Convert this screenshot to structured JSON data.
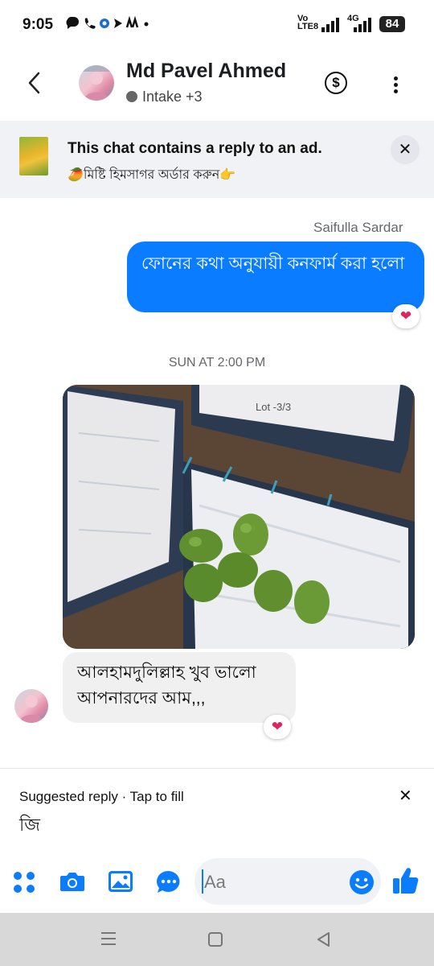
{
  "status_bar": {
    "time": "9:05",
    "network_left": "Vo",
    "network_left2": "LTE8",
    "network_right": "4G",
    "battery": "84"
  },
  "header": {
    "contact_name": "Md Pavel Ahmed",
    "subtitle": "Intake +3",
    "icons": [
      "back-arrow-icon",
      "dollar-icon",
      "more-vertical-icon"
    ]
  },
  "ad_banner": {
    "title": "This chat contains a reply to an ad.",
    "subtitle": "🥭মিষ্টি হিমসাগর অর্ডার করুন👉"
  },
  "messages": {
    "outgoing_sender": "Saifulla Sardar",
    "outgoing_text": "ফোনের কথা অনুযায়ী কনফার্ম করা হলো",
    "outgoing_reaction": "❤",
    "day_separator": "SUN AT 2:00 PM",
    "photo_label": "Lot -3/3",
    "incoming_text": "আলহামদুলিল্লাহ খুব ভালো আপনারদের আম,,,",
    "incoming_reaction": "❤"
  },
  "suggested_reply": {
    "label": "Suggested reply · Tap to fill",
    "text": "জি"
  },
  "composer": {
    "placeholder": "Aa",
    "icons": [
      "apps-icon",
      "camera-icon",
      "gallery-icon",
      "chat-more-icon",
      "emoji-icon",
      "thumbs-up-icon"
    ]
  },
  "colors": {
    "accent": "#0a7cff",
    "banner_bg": "#f0f2f5",
    "heart": "#e0245e"
  }
}
